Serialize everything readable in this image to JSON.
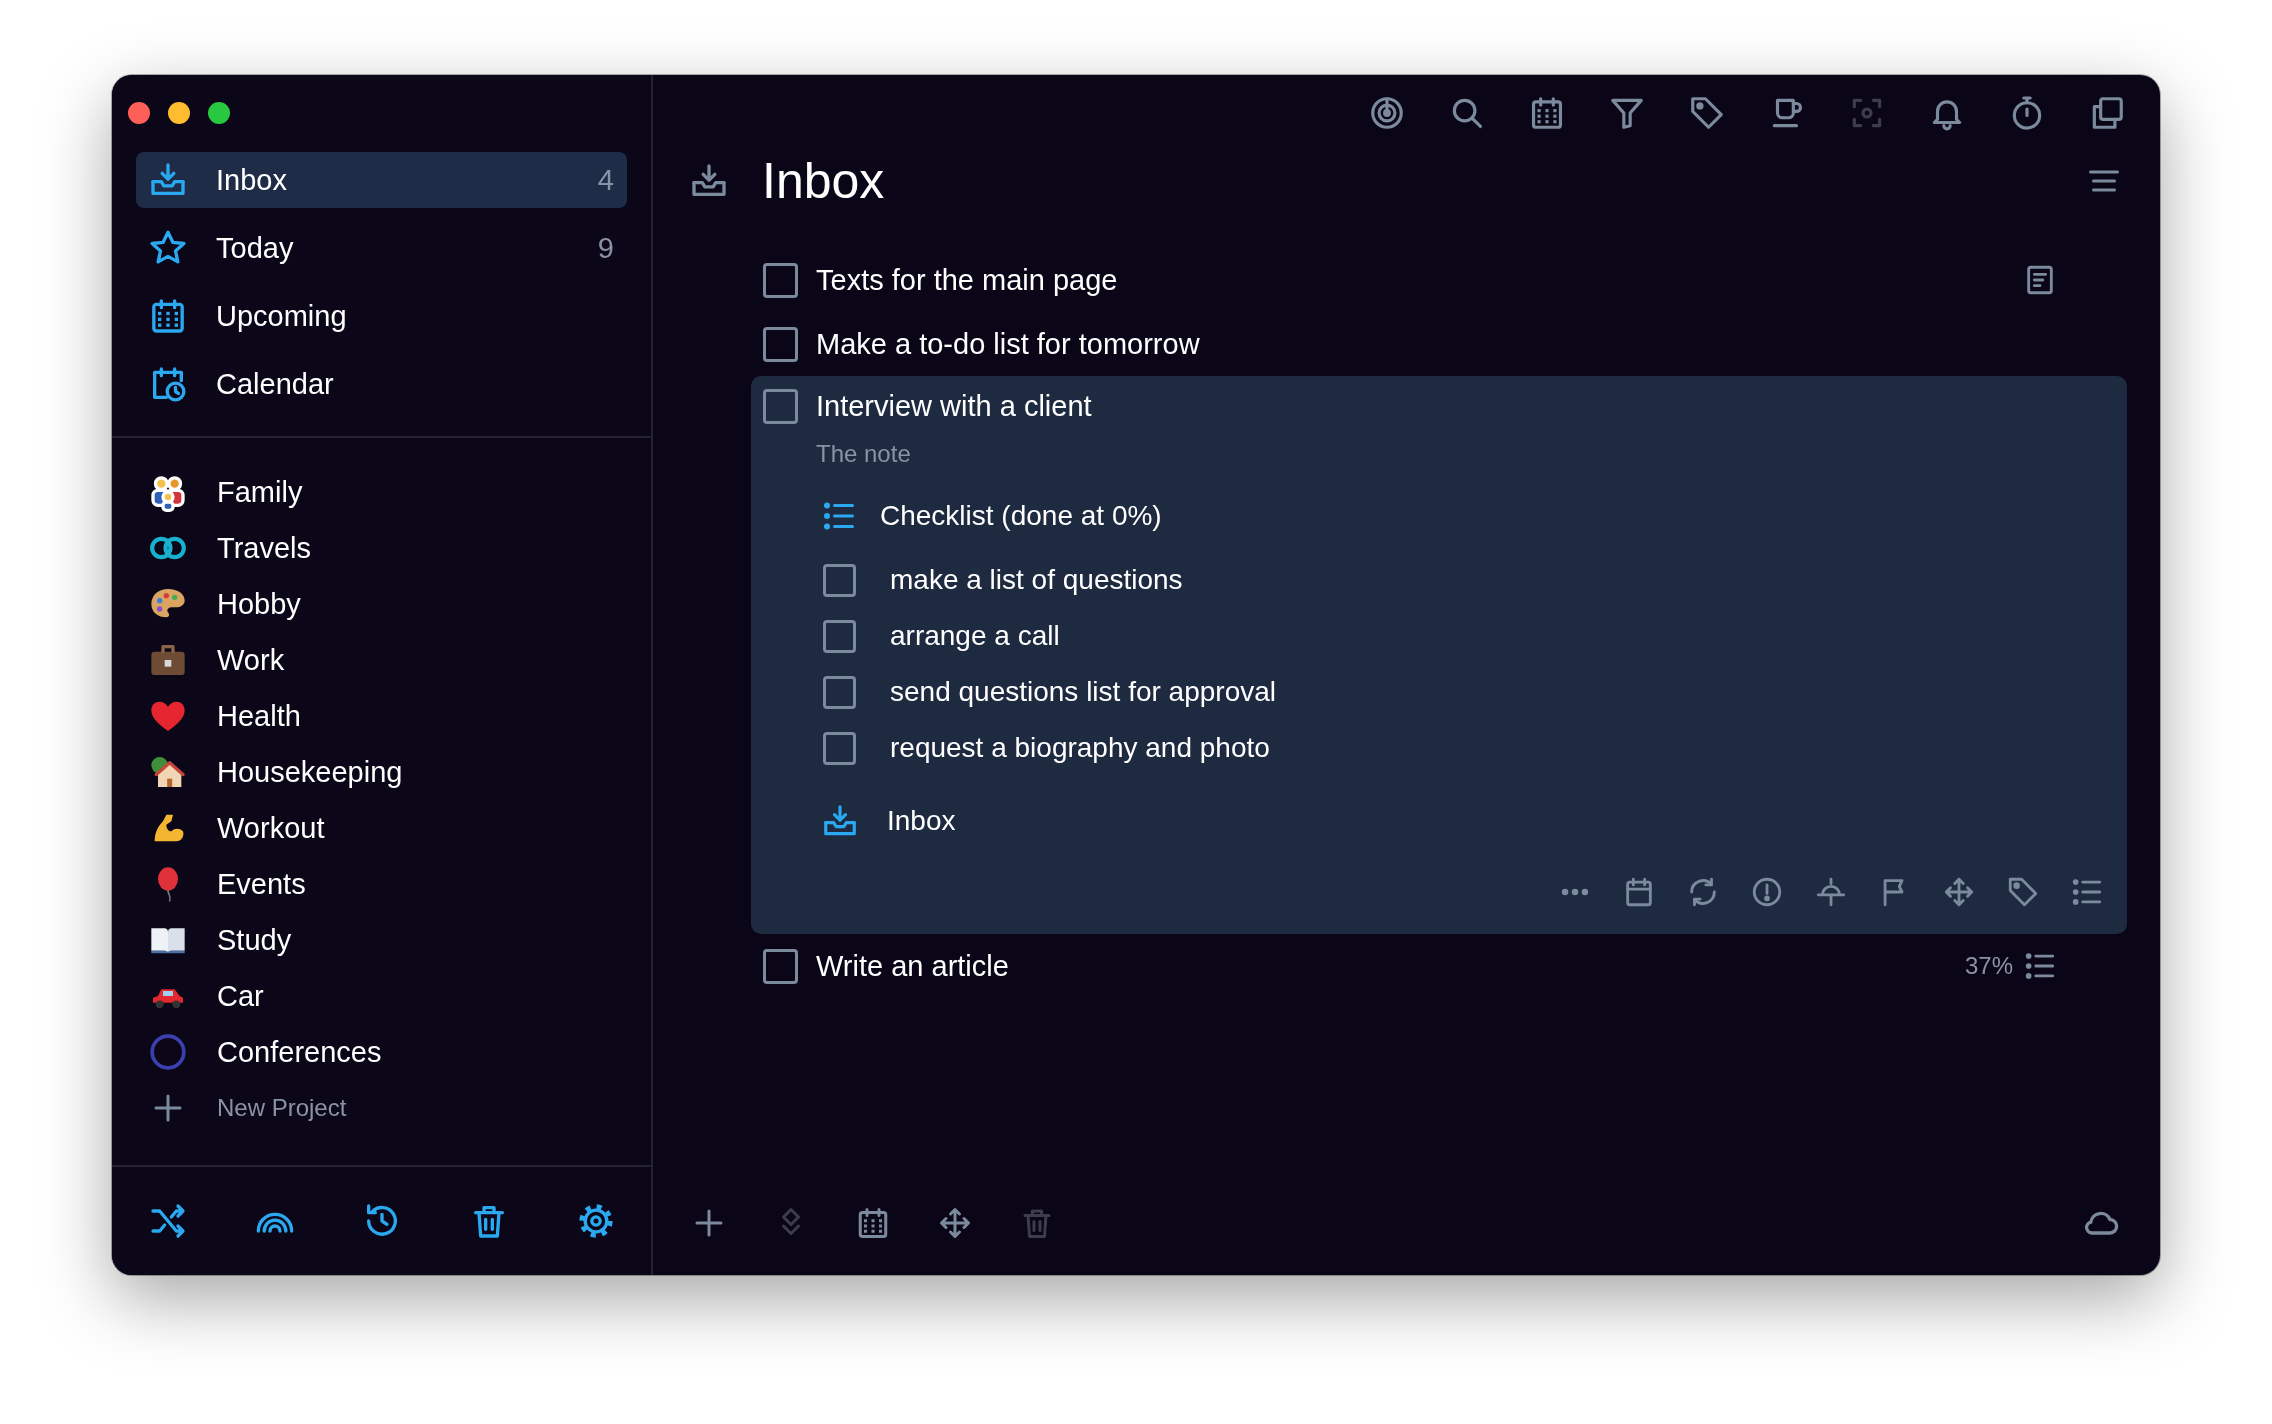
{
  "sidebar": {
    "views": [
      {
        "kind": "inbox",
        "label": "Inbox",
        "count": "4",
        "selected": true
      },
      {
        "kind": "today",
        "label": "Today",
        "count": "9",
        "selected": false
      },
      {
        "kind": "upcoming",
        "label": "Upcoming",
        "selected": false
      },
      {
        "kind": "calendar",
        "label": "Calendar",
        "selected": false
      }
    ],
    "projects": [
      {
        "kind": "family",
        "label": "Family",
        "selected": false
      },
      {
        "kind": "travels",
        "label": "Travels",
        "selected": false
      },
      {
        "kind": "hobby",
        "label": "Hobby",
        "selected": false
      },
      {
        "kind": "work",
        "label": "Work",
        "selected": false
      },
      {
        "kind": "health",
        "label": "Health",
        "selected": false
      },
      {
        "kind": "housekeeping",
        "label": "Housekeeping",
        "selected": false
      },
      {
        "kind": "workout",
        "label": "Workout",
        "selected": false
      },
      {
        "kind": "events",
        "label": "Events",
        "selected": false
      },
      {
        "kind": "study",
        "label": "Study",
        "selected": false
      },
      {
        "kind": "car",
        "label": "Car",
        "selected": false
      },
      {
        "kind": "conferences",
        "label": "Conferences",
        "selected": false
      }
    ],
    "new_project": "New Project"
  },
  "main": {
    "title": "Inbox",
    "tasks": [
      {
        "kind": "plain",
        "title": "Texts for the main page",
        "checked": false,
        "has_note": true
      },
      {
        "kind": "plain",
        "title": "Make a to-do list for tomorrow",
        "checked": false,
        "has_note": false
      },
      {
        "kind": "expanded",
        "title": "Interview with a client",
        "checked": false,
        "has_note": false,
        "note": "The note",
        "checklist": {
          "title": "Checklist (done at 0%)",
          "items": [
            {
              "label": "make a list of questions",
              "checked": false
            },
            {
              "label": "arrange a call",
              "checked": false
            },
            {
              "label": "send questions list for approval",
              "checked": false
            },
            {
              "label": "request a biography and photo",
              "checked": false
            }
          ]
        },
        "project": "Inbox"
      },
      {
        "kind": "plain",
        "title": "Write an article",
        "checked": false,
        "has_note": false,
        "progress": "37%"
      }
    ]
  }
}
